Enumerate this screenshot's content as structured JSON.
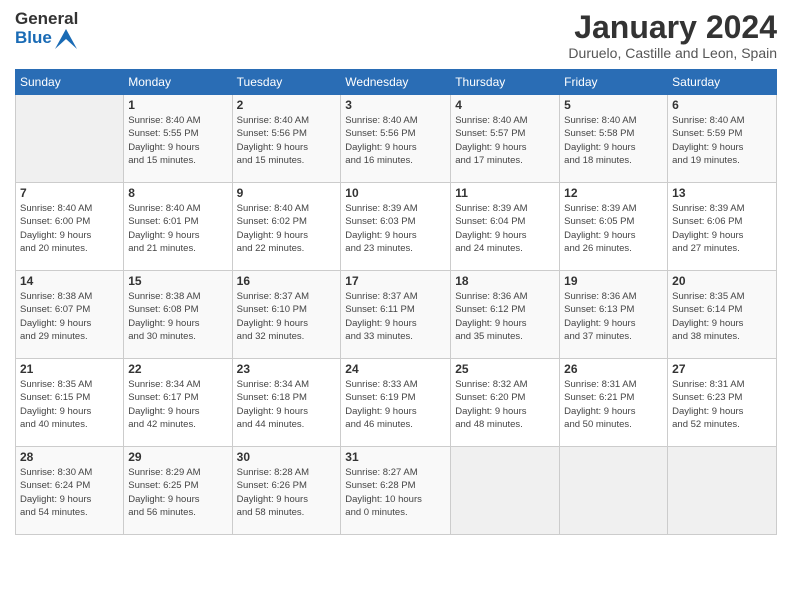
{
  "header": {
    "logo_line1": "General",
    "logo_line2": "Blue",
    "month": "January 2024",
    "location": "Duruelo, Castille and Leon, Spain"
  },
  "weekdays": [
    "Sunday",
    "Monday",
    "Tuesday",
    "Wednesday",
    "Thursday",
    "Friday",
    "Saturday"
  ],
  "weeks": [
    [
      {
        "day": "",
        "info": ""
      },
      {
        "day": "1",
        "info": "Sunrise: 8:40 AM\nSunset: 5:55 PM\nDaylight: 9 hours\nand 15 minutes."
      },
      {
        "day": "2",
        "info": "Sunrise: 8:40 AM\nSunset: 5:56 PM\nDaylight: 9 hours\nand 15 minutes."
      },
      {
        "day": "3",
        "info": "Sunrise: 8:40 AM\nSunset: 5:56 PM\nDaylight: 9 hours\nand 16 minutes."
      },
      {
        "day": "4",
        "info": "Sunrise: 8:40 AM\nSunset: 5:57 PM\nDaylight: 9 hours\nand 17 minutes."
      },
      {
        "day": "5",
        "info": "Sunrise: 8:40 AM\nSunset: 5:58 PM\nDaylight: 9 hours\nand 18 minutes."
      },
      {
        "day": "6",
        "info": "Sunrise: 8:40 AM\nSunset: 5:59 PM\nDaylight: 9 hours\nand 19 minutes."
      }
    ],
    [
      {
        "day": "7",
        "info": "Sunrise: 8:40 AM\nSunset: 6:00 PM\nDaylight: 9 hours\nand 20 minutes."
      },
      {
        "day": "8",
        "info": "Sunrise: 8:40 AM\nSunset: 6:01 PM\nDaylight: 9 hours\nand 21 minutes."
      },
      {
        "day": "9",
        "info": "Sunrise: 8:40 AM\nSunset: 6:02 PM\nDaylight: 9 hours\nand 22 minutes."
      },
      {
        "day": "10",
        "info": "Sunrise: 8:39 AM\nSunset: 6:03 PM\nDaylight: 9 hours\nand 23 minutes."
      },
      {
        "day": "11",
        "info": "Sunrise: 8:39 AM\nSunset: 6:04 PM\nDaylight: 9 hours\nand 24 minutes."
      },
      {
        "day": "12",
        "info": "Sunrise: 8:39 AM\nSunset: 6:05 PM\nDaylight: 9 hours\nand 26 minutes."
      },
      {
        "day": "13",
        "info": "Sunrise: 8:39 AM\nSunset: 6:06 PM\nDaylight: 9 hours\nand 27 minutes."
      }
    ],
    [
      {
        "day": "14",
        "info": "Sunrise: 8:38 AM\nSunset: 6:07 PM\nDaylight: 9 hours\nand 29 minutes."
      },
      {
        "day": "15",
        "info": "Sunrise: 8:38 AM\nSunset: 6:08 PM\nDaylight: 9 hours\nand 30 minutes."
      },
      {
        "day": "16",
        "info": "Sunrise: 8:37 AM\nSunset: 6:10 PM\nDaylight: 9 hours\nand 32 minutes."
      },
      {
        "day": "17",
        "info": "Sunrise: 8:37 AM\nSunset: 6:11 PM\nDaylight: 9 hours\nand 33 minutes."
      },
      {
        "day": "18",
        "info": "Sunrise: 8:36 AM\nSunset: 6:12 PM\nDaylight: 9 hours\nand 35 minutes."
      },
      {
        "day": "19",
        "info": "Sunrise: 8:36 AM\nSunset: 6:13 PM\nDaylight: 9 hours\nand 37 minutes."
      },
      {
        "day": "20",
        "info": "Sunrise: 8:35 AM\nSunset: 6:14 PM\nDaylight: 9 hours\nand 38 minutes."
      }
    ],
    [
      {
        "day": "21",
        "info": "Sunrise: 8:35 AM\nSunset: 6:15 PM\nDaylight: 9 hours\nand 40 minutes."
      },
      {
        "day": "22",
        "info": "Sunrise: 8:34 AM\nSunset: 6:17 PM\nDaylight: 9 hours\nand 42 minutes."
      },
      {
        "day": "23",
        "info": "Sunrise: 8:34 AM\nSunset: 6:18 PM\nDaylight: 9 hours\nand 44 minutes."
      },
      {
        "day": "24",
        "info": "Sunrise: 8:33 AM\nSunset: 6:19 PM\nDaylight: 9 hours\nand 46 minutes."
      },
      {
        "day": "25",
        "info": "Sunrise: 8:32 AM\nSunset: 6:20 PM\nDaylight: 9 hours\nand 48 minutes."
      },
      {
        "day": "26",
        "info": "Sunrise: 8:31 AM\nSunset: 6:21 PM\nDaylight: 9 hours\nand 50 minutes."
      },
      {
        "day": "27",
        "info": "Sunrise: 8:31 AM\nSunset: 6:23 PM\nDaylight: 9 hours\nand 52 minutes."
      }
    ],
    [
      {
        "day": "28",
        "info": "Sunrise: 8:30 AM\nSunset: 6:24 PM\nDaylight: 9 hours\nand 54 minutes."
      },
      {
        "day": "29",
        "info": "Sunrise: 8:29 AM\nSunset: 6:25 PM\nDaylight: 9 hours\nand 56 minutes."
      },
      {
        "day": "30",
        "info": "Sunrise: 8:28 AM\nSunset: 6:26 PM\nDaylight: 9 hours\nand 58 minutes."
      },
      {
        "day": "31",
        "info": "Sunrise: 8:27 AM\nSunset: 6:28 PM\nDaylight: 10 hours\nand 0 minutes."
      },
      {
        "day": "",
        "info": ""
      },
      {
        "day": "",
        "info": ""
      },
      {
        "day": "",
        "info": ""
      }
    ]
  ]
}
